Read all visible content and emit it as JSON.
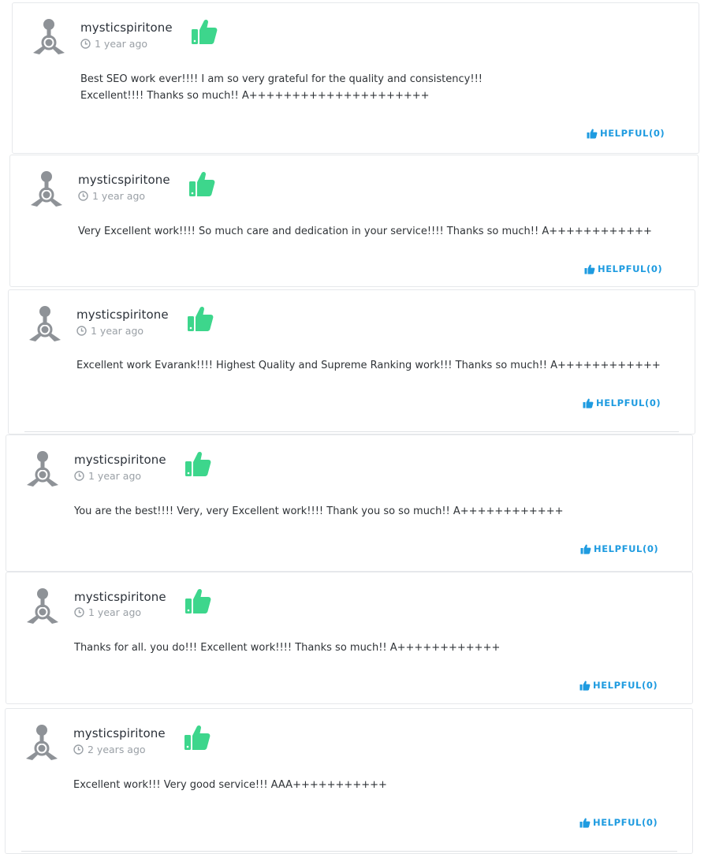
{
  "reviews": [
    {
      "username": "mysticspiritone",
      "time": "1 year ago",
      "text": "Best SEO work ever!!!! I am so very grateful for the quality and consistency!!!\nExcellent!!!! Thanks so much!! A+++++++++++++++++++++",
      "helpful": "HELPFUL(0)"
    },
    {
      "username": "mysticspiritone",
      "time": "1 year ago",
      "text": "Very Excellent work!!!! So much care and dedication in your service!!!! Thanks so much!! A++++++++++++",
      "helpful": "HELPFUL(0)"
    },
    {
      "username": "mysticspiritone",
      "time": "1 year ago",
      "text": "Excellent work Evarank!!!! Highest Quality and Supreme Ranking work!!! Thanks so much!! A++++++++++++",
      "helpful": "HELPFUL(0)"
    },
    {
      "username": "mysticspiritone",
      "time": "1 year ago",
      "text": "You are the best!!!! Very, very Excellent work!!!! Thank you so so much!! A++++++++++++",
      "helpful": "HELPFUL(0)"
    },
    {
      "username": "mysticspiritone",
      "time": "1 year ago",
      "text": "Thanks for all. you do!!! Excellent work!!!! Thanks so much!! A++++++++++++",
      "helpful": "HELPFUL(0)"
    },
    {
      "username": "mysticspiritone",
      "time": "2 years ago",
      "text": "Excellent work!!! Very good service!!! AAA+++++++++++",
      "helpful": "HELPFUL(0)"
    }
  ],
  "icons": {
    "avatar": "default-user-avatar-icon",
    "clock": "clock-icon",
    "thumb": "thumbs-up-icon",
    "helpful": "small-thumbs-up-icon"
  },
  "colors": {
    "thumb_green": "#3dd68c",
    "helpful_blue": "#1e9be0",
    "avatar_gray": "#8e9297"
  }
}
